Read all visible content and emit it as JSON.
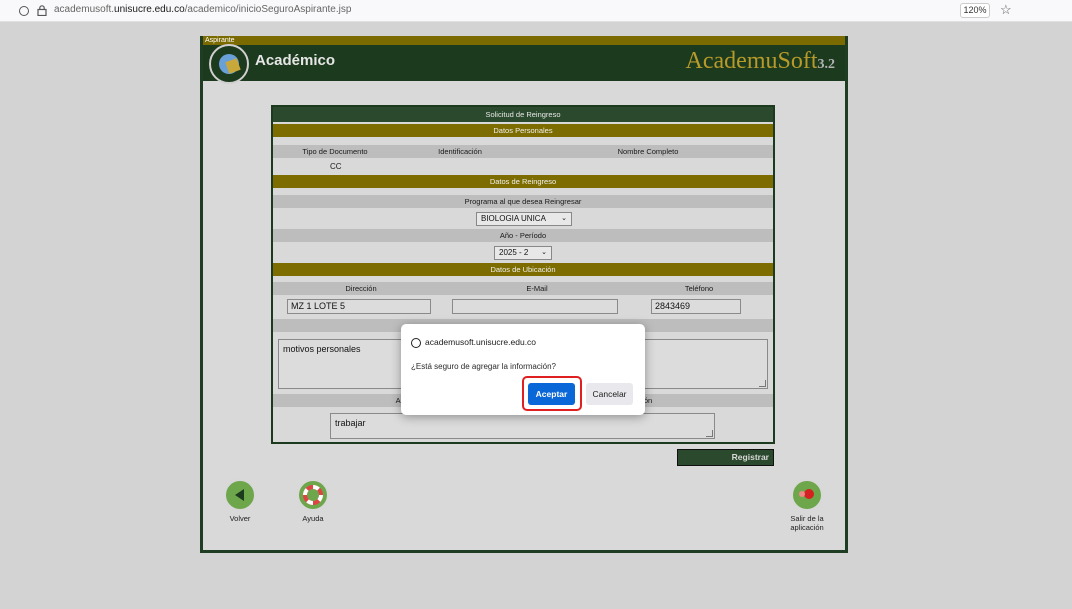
{
  "browser": {
    "url_prefix": "academusoft.",
    "url_domain": "unisucre.edu.co",
    "url_path": "/academico/inicioSeguroAspirante.jsp",
    "zoom": "120%"
  },
  "app": {
    "top_label": "Aspirante",
    "title": "Académico",
    "brand": "AcademuSoft",
    "brand_version": "3.2"
  },
  "form": {
    "title": "Solicitud de Reingreso",
    "section_personal": "Datos Personales",
    "col_tipo": "Tipo de Documento",
    "col_ident": "Identificación",
    "col_nombre": "Nombre Completo",
    "tipo_value": "CC",
    "section_reingreso": "Datos de Reingreso",
    "programa_label": "Programa al que desea Reingresar",
    "programa_value": "BIOLOGIA UNICA",
    "periodo_label": "Año - Período",
    "periodo_value": "2025 - 2",
    "section_ubicacion": "Datos de Ubicación",
    "col_direccion": "Dirección",
    "col_email": "E-Mail",
    "col_telefono": "Teléfono",
    "direccion_value": "MZ 1 LOTE 5",
    "email_value": "",
    "telefono_value": "2843469",
    "motivos_value": "motivos personales",
    "activity_label_left": "Ac",
    "activity_label_right": "ón",
    "actividad_value": "trabajar",
    "registrar_label": "Registrar"
  },
  "nav": {
    "volver": "Volver",
    "ayuda": "Ayuda",
    "salir_line1": "Salir de la",
    "salir_line2": "aplicación"
  },
  "dialog": {
    "origin": "academusoft.unisucre.edu.co",
    "message": "¿Está seguro de agregar la información?",
    "accept_label": "Aceptar",
    "cancel_label": "Cancelar"
  }
}
